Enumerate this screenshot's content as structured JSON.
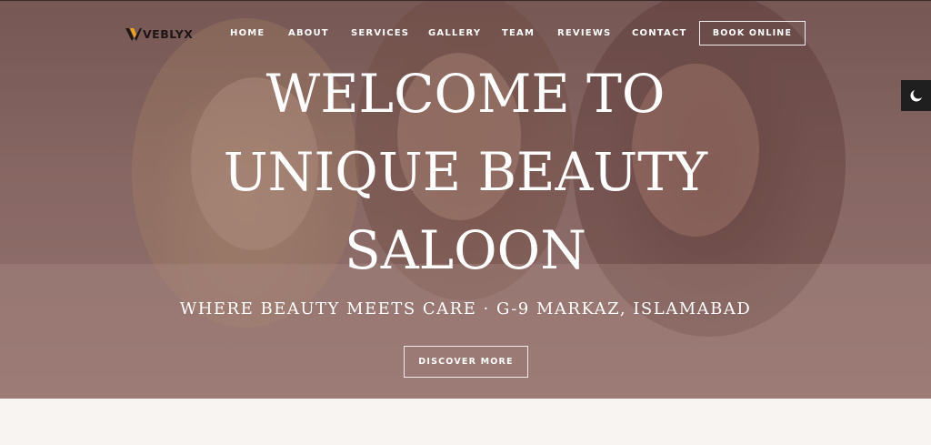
{
  "brand": {
    "logo_text": "VEBLYX",
    "logo_accent_color": "#f0a51e",
    "logo_dark_color": "#1e1616"
  },
  "nav": {
    "items": [
      {
        "label": "HOME"
      },
      {
        "label": "ABOUT"
      },
      {
        "label": "SERVICES"
      },
      {
        "label": "GALLERY"
      },
      {
        "label": "TEAM"
      },
      {
        "label": "REVIEWS"
      },
      {
        "label": "CONTACT"
      }
    ],
    "cta_label": "BOOK ONLINE"
  },
  "theme_toggle": {
    "icon": "moon-icon"
  },
  "hero": {
    "title_lines": [
      "WELCOME TO",
      "UNIQUE BEAUTY",
      "SALOON"
    ],
    "subtitle": "WHERE BEAUTY MEETS CARE · G-9 MARKAZ, ISLAMABAD",
    "cta_label": "DISCOVER MORE",
    "overlay_color": "#6e4a48"
  },
  "colors": {
    "page_background": "#f8f4f1",
    "text_on_hero": "#ffffff",
    "toggle_background": "#1f1f1f"
  }
}
